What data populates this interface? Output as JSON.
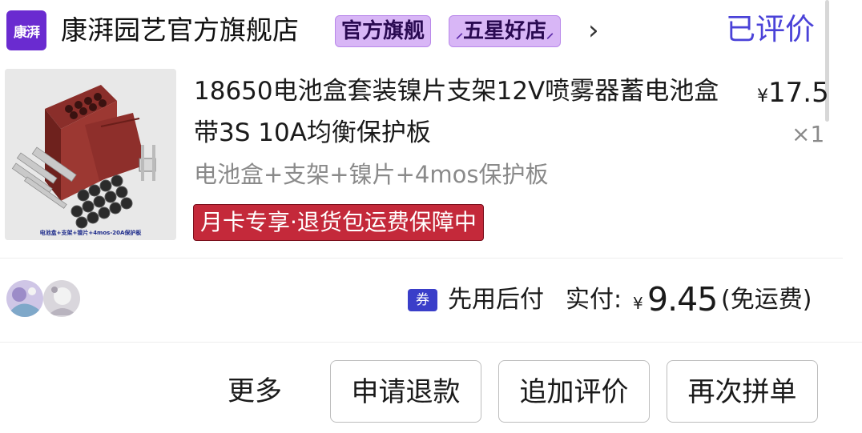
{
  "shop": {
    "logo_text": "康湃",
    "name": "康湃园艺官方旗舰店",
    "badge_official": "官方旗舰",
    "badge_star": "五星好店",
    "review_status": "已评价"
  },
  "product": {
    "title": "18650电池盒套装镍片支架12V喷雾器蓄电池盒带3S 10A均衡保护板",
    "price_symbol": "¥",
    "price": "17.5",
    "quantity": "×1",
    "spec": "电池盒+支架+镍片+4mos保护板",
    "benefit": "月卡专享·退货包运费保障中",
    "image_caption": "电池盒+支架+镍片+4mos-20A保护板"
  },
  "payment": {
    "coupon_label": "券",
    "pay_later": "先用后付",
    "paid_label": "实付:",
    "currency": "¥",
    "amount": "9.45",
    "shipping_note": "(免运费)"
  },
  "actions": {
    "more": "更多",
    "refund": "申请退款",
    "add_review": "追加评价",
    "reorder": "再次拼单"
  },
  "colors": {
    "accent": "#4a42d8",
    "badge_bg": "#d8b6f6",
    "benefit_bg": "#c4293a",
    "logo_bg": "#6a2bd0"
  }
}
